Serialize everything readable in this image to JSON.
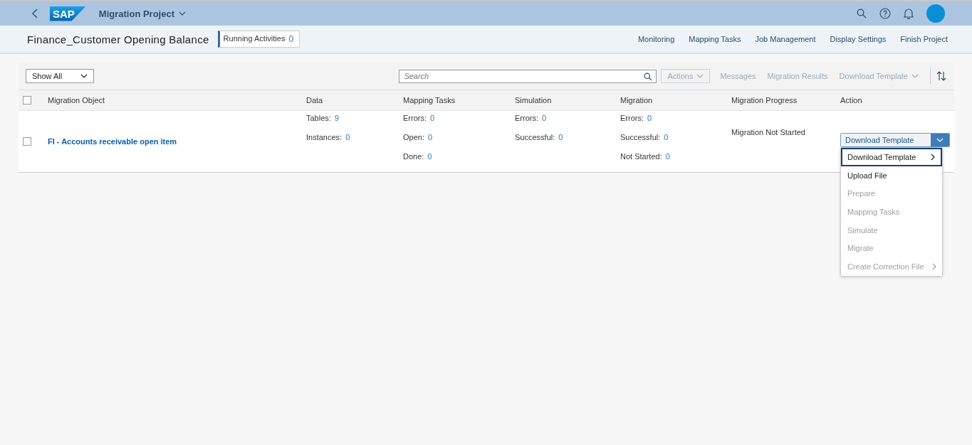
{
  "shell": {
    "logo": "SAP",
    "title": "Migration Project"
  },
  "header": {
    "title": "Finance_Customer Opening Balance",
    "badge": {
      "label": "Running Activities",
      "count": "0"
    },
    "links": [
      "Monitoring",
      "Mapping Tasks",
      "Job Management",
      "Display Settings",
      "Finish Project"
    ]
  },
  "toolbar": {
    "filter": "Show All",
    "search": {
      "placeholder": "Search"
    },
    "buttons": [
      {
        "label": "Actions",
        "kind": "menu",
        "disabled": true
      },
      {
        "label": "Messages",
        "kind": "text",
        "disabled": true
      },
      {
        "label": "Migration Results",
        "kind": "text",
        "disabled": true
      },
      {
        "label": "Download Template",
        "kind": "textmenu",
        "disabled": true
      }
    ]
  },
  "table": {
    "all_checked": false,
    "columns": [
      "Migration Object",
      "Data",
      "Mapping Tasks",
      "Simulation",
      "Migration",
      "Migration Progress",
      "Action"
    ],
    "rows": [
      {
        "checked": false,
        "object": "FI - Accounts receivable open item",
        "data": [
          {
            "label": "Tables:",
            "value": "9"
          },
          {
            "label": "Instances:",
            "value": "0"
          }
        ],
        "mapping": [
          {
            "label": "Errors:",
            "value": "0"
          },
          {
            "label": "Open:",
            "value": "0"
          },
          {
            "label": "Done:",
            "value": "0"
          }
        ],
        "simulation": [
          {
            "label": "Errors:",
            "value": "0"
          },
          {
            "label": "Successful:",
            "value": "0"
          }
        ],
        "migration": [
          {
            "label": "Errors:",
            "value": "0"
          },
          {
            "label": "Successful:",
            "value": "0"
          },
          {
            "label": "Not Started:",
            "value": "0"
          }
        ],
        "progress": "Migration Not Started",
        "action": "Download Template"
      }
    ]
  },
  "menu": [
    {
      "label": "Download Template",
      "selected": true,
      "disabled": false,
      "submenu": true
    },
    {
      "label": "Upload File",
      "selected": false,
      "disabled": false,
      "submenu": false
    },
    {
      "label": "Prepare",
      "selected": false,
      "disabled": true,
      "submenu": false
    },
    {
      "label": "Mapping Tasks",
      "selected": false,
      "disabled": true,
      "submenu": false
    },
    {
      "label": "Simulate",
      "selected": false,
      "disabled": true,
      "submenu": false
    },
    {
      "label": "Migrate",
      "selected": false,
      "disabled": true,
      "submenu": false
    },
    {
      "label": "Create Correction File",
      "selected": false,
      "disabled": true,
      "submenu": true
    }
  ]
}
